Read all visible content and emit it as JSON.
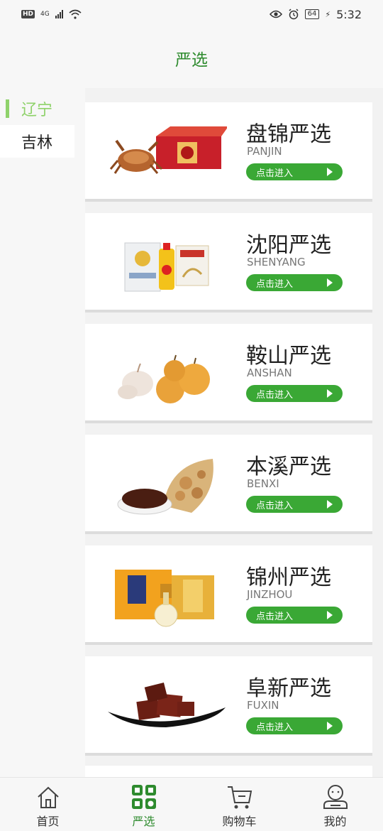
{
  "status_bar": {
    "hd": "HD",
    "network": "4G",
    "battery": "64",
    "time": "5:32"
  },
  "header": {
    "title": "严选"
  },
  "sidebar": {
    "items": [
      {
        "label": "辽宁",
        "active": true
      },
      {
        "label": "吉林",
        "active": false
      }
    ]
  },
  "cards": [
    {
      "name": "盘锦严选",
      "pinyin": "PANJIN",
      "button": "点击进入",
      "image": "crab-and-gift-box"
    },
    {
      "name": "沈阳严选",
      "pinyin": "SHENYANG",
      "button": "点击进入",
      "image": "rice-oil-flour"
    },
    {
      "name": "鞍山严选",
      "pinyin": "ANSHAN",
      "button": "点击进入",
      "image": "garlic-and-pears"
    },
    {
      "name": "本溪严选",
      "pinyin": "BENXI",
      "button": "点击进入",
      "image": "herbal-slices-and-powder"
    },
    {
      "name": "锦州严选",
      "pinyin": "JINZHOU",
      "button": "点击进入",
      "image": "liquor-gift-box"
    },
    {
      "name": "阜新严选",
      "pinyin": "FUXIN",
      "button": "点击进入",
      "image": "dried-meat-on-plate"
    }
  ],
  "tabbar": {
    "items": [
      {
        "label": "首页",
        "icon": "home-icon",
        "active": false
      },
      {
        "label": "严选",
        "icon": "grid-icon",
        "active": true
      },
      {
        "label": "购物车",
        "icon": "cart-icon",
        "active": false
      },
      {
        "label": "我的",
        "icon": "profile-icon",
        "active": false
      }
    ]
  },
  "colors": {
    "accent": "#2e8b2e",
    "button": "#3aa835",
    "sidebar_active": "#8fd26b"
  }
}
